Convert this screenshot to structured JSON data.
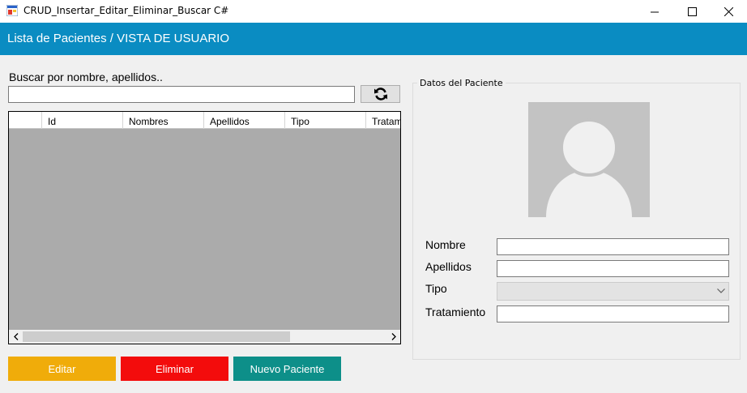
{
  "window": {
    "title": "CRUD_Insertar_Editar_Eliminar_Buscar C#",
    "controls": [
      "minimize",
      "maximize",
      "close"
    ]
  },
  "header": {
    "title": "Lista de Pacientes / VISTA DE USUARIO",
    "background": "#0a8cc2"
  },
  "search": {
    "label": "Buscar por nombre, apellidos..",
    "value": "",
    "refresh_icon": "refresh-icon"
  },
  "grid": {
    "columns": [
      "",
      "Id",
      "Nombres",
      "Apellidos",
      "Tipo",
      "Tratami"
    ],
    "rows": []
  },
  "actions": {
    "edit_label": "Editar",
    "delete_label": "Eliminar",
    "new_label": "Nuevo Paciente",
    "edit_color": "#f0ac0a",
    "delete_color": "#f30c0c",
    "new_color": "#0d8f89"
  },
  "details": {
    "group_title": "Datos del Paciente",
    "photo_icon": "user-placeholder-icon",
    "fields": {
      "nombre_label": "Nombre",
      "nombre_value": "",
      "apellidos_label": "Apellidos",
      "apellidos_value": "",
      "tipo_label": "Tipo",
      "tipo_value": "",
      "tratamiento_label": "Tratamiento",
      "tratamiento_value": ""
    }
  }
}
